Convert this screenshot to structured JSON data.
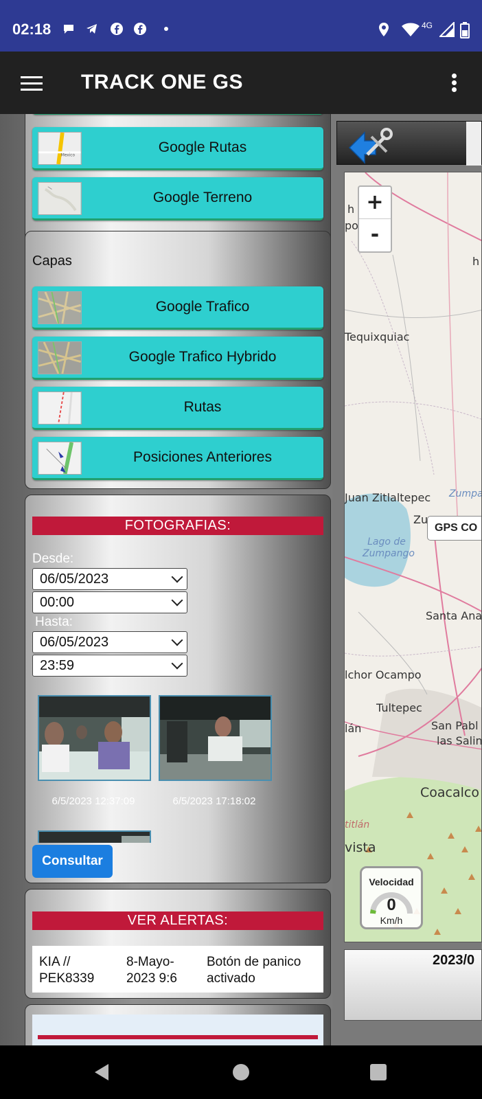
{
  "status_bar": {
    "time": "02:18",
    "network": "4G",
    "icons": [
      "chat-icon",
      "telegram-icon",
      "facebook-icon",
      "facebook-icon",
      "dot-icon",
      "location-icon",
      "wifi-icon",
      "signal-icon",
      "battery-icon"
    ]
  },
  "app_bar": {
    "title": "TRACK ONE GS"
  },
  "map_types": {
    "items": [
      {
        "label": "Google Rutas",
        "thumb": "roads-map-thumb"
      },
      {
        "label": "Google Terreno",
        "thumb": "terrain-map-thumb"
      }
    ]
  },
  "layers": {
    "heading": "Capas",
    "items": [
      {
        "label": "Google Trafico",
        "thumb": "traffic-thumb"
      },
      {
        "label": "Google Trafico Hybrido",
        "thumb": "traffic-hybrid-thumb"
      },
      {
        "label": "Rutas",
        "thumb": "routes-thumb"
      },
      {
        "label": "Posiciones Anteriores",
        "thumb": "previous-positions-thumb"
      }
    ]
  },
  "photos": {
    "heading": "FOTOGRAFIAS:",
    "from_label": "Desde:",
    "from_date": "06/05/2023",
    "from_time": "00:00",
    "to_label": "Hasta:",
    "to_date": "06/05/2023",
    "to_time": "23:59",
    "items": [
      {
        "caption": "6/5/2023 12:37:09"
      },
      {
        "caption": "6/5/2023 17:18:02"
      }
    ],
    "query_button": "Consultar"
  },
  "alerts": {
    "heading": "VER ALERTAS:",
    "rows": [
      {
        "vehicle": "KIA // PEK8339",
        "date": "8-Mayo-2023 9:6",
        "event": "Botón de panico activado"
      }
    ]
  },
  "map": {
    "zoom_in": "+",
    "zoom_out": "-",
    "places": [
      "Tequixquiac",
      "Juan Zitlaltepec",
      "Zumpango",
      "Lago de Zumpango",
      "Santa Ana",
      "lchor Ocampo",
      "Tultepec",
      "San Pabl",
      "las Salin",
      "Coacalco",
      "vista",
      "lán",
      "de",
      "po",
      "h",
      "titlán"
    ],
    "gps_tag": "GPS CO",
    "speed_label": "Velocidad",
    "speed_value": "0",
    "speed_unit": "Km/h",
    "date_fragment": "2023/0",
    "colors": {
      "road": "#e07b9e",
      "water": "#aad3df",
      "land": "#f2efe9",
      "park": "#cfe6b8"
    }
  }
}
